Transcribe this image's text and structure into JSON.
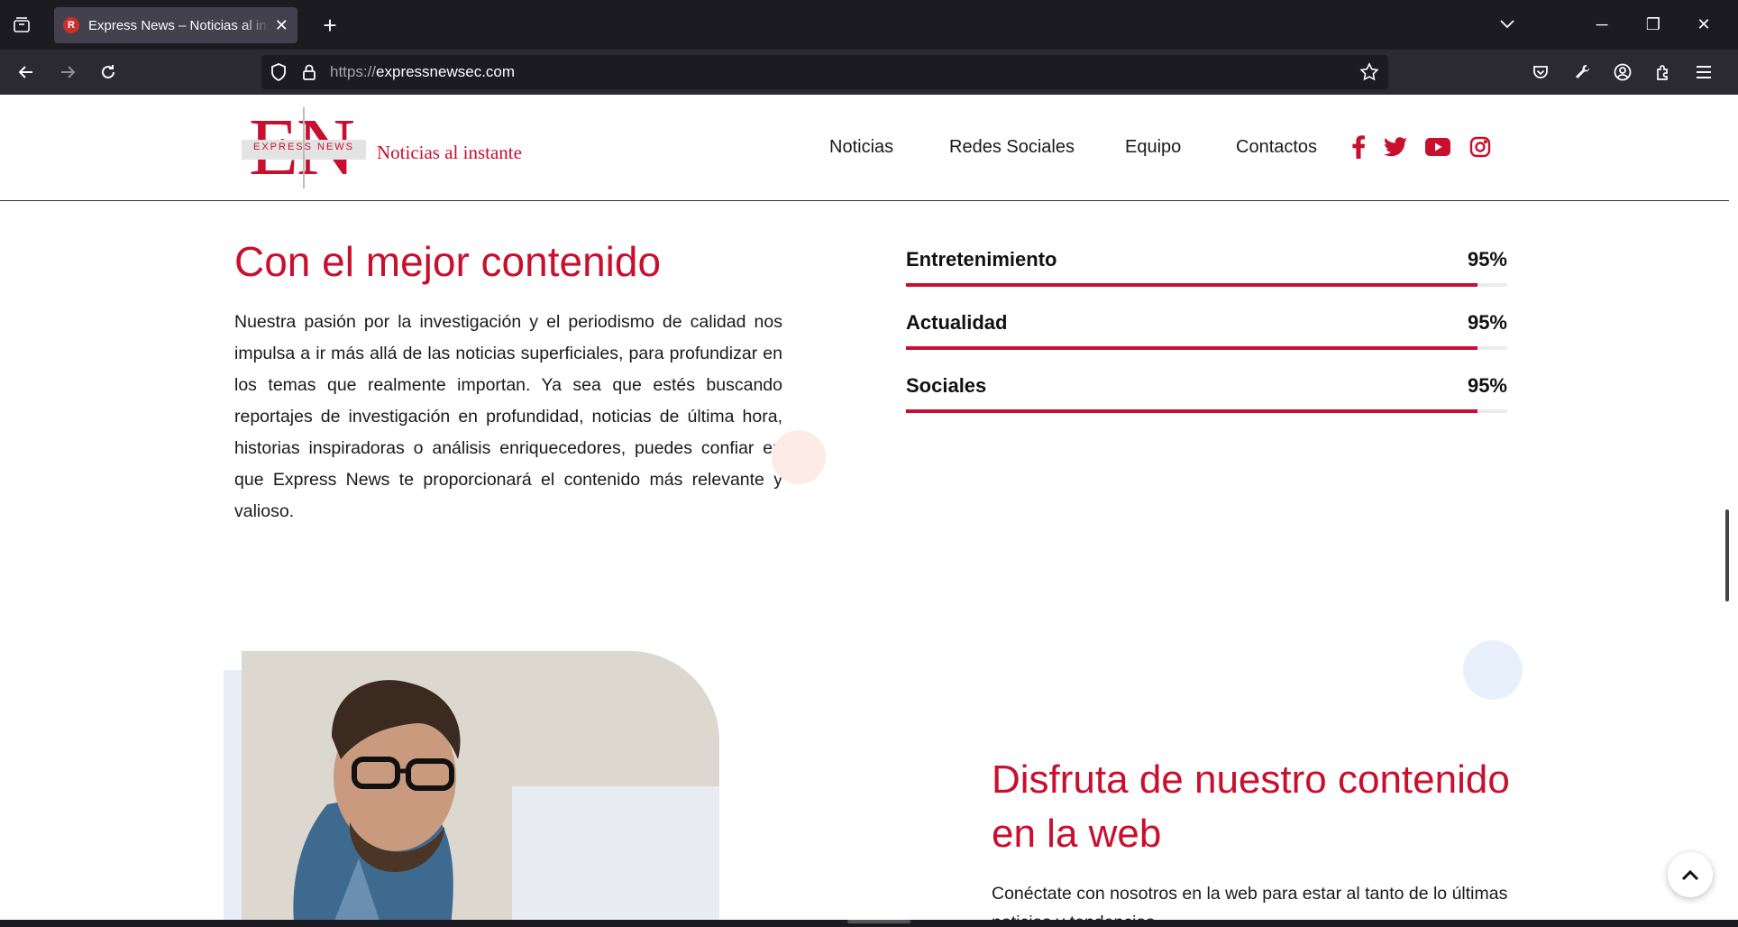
{
  "browser": {
    "tab": {
      "favicon_letter": "R",
      "title": "Express News – Noticias al instante",
      "close": "✕"
    },
    "new_tab": "+",
    "url": {
      "protocol": "https://",
      "host": "expressnewsec.com"
    },
    "window_controls": {
      "minimize": "─",
      "restore": "❐",
      "close": "✕",
      "list": "⌄"
    }
  },
  "header": {
    "logo": {
      "letters": "EN",
      "band_text": "EXPRESS NEWS",
      "tagline": "Noticias al instante"
    },
    "menu": [
      "Noticias",
      "Redes Sociales",
      "Equipo",
      "Contactos"
    ],
    "social": [
      "facebook-icon",
      "twitter-icon",
      "youtube-icon",
      "instagram-icon"
    ]
  },
  "section1": {
    "title": "Con el mejor contenido",
    "paragraph": "Nuestra pasión por la investigación y el periodismo de calidad nos impulsa a ir más allá de las noticias superficiales, para profundizar en los temas que realmente importan. Ya sea que estés buscando reportajes de investigación en profundidad, noticias de última hora, historias inspiradoras o análisis enriquecedores, puedes confiar en que Express News te proporcionará el contenido más relevante y valioso.",
    "skills": [
      {
        "label": "Entretenimiento",
        "percent": "95%",
        "value": 95
      },
      {
        "label": "Actualidad",
        "percent": "95%",
        "value": 95
      },
      {
        "label": "Sociales",
        "percent": "95%",
        "value": 95
      }
    ]
  },
  "section2": {
    "title": "Disfruta de nuestro contenido en la web",
    "paragraph": "Conéctate con nosotros en la web para estar al tanto de lo últimas noticias y tendencias."
  },
  "colors": {
    "brand_red": "#c8102e",
    "text": "#1a1a1a"
  }
}
